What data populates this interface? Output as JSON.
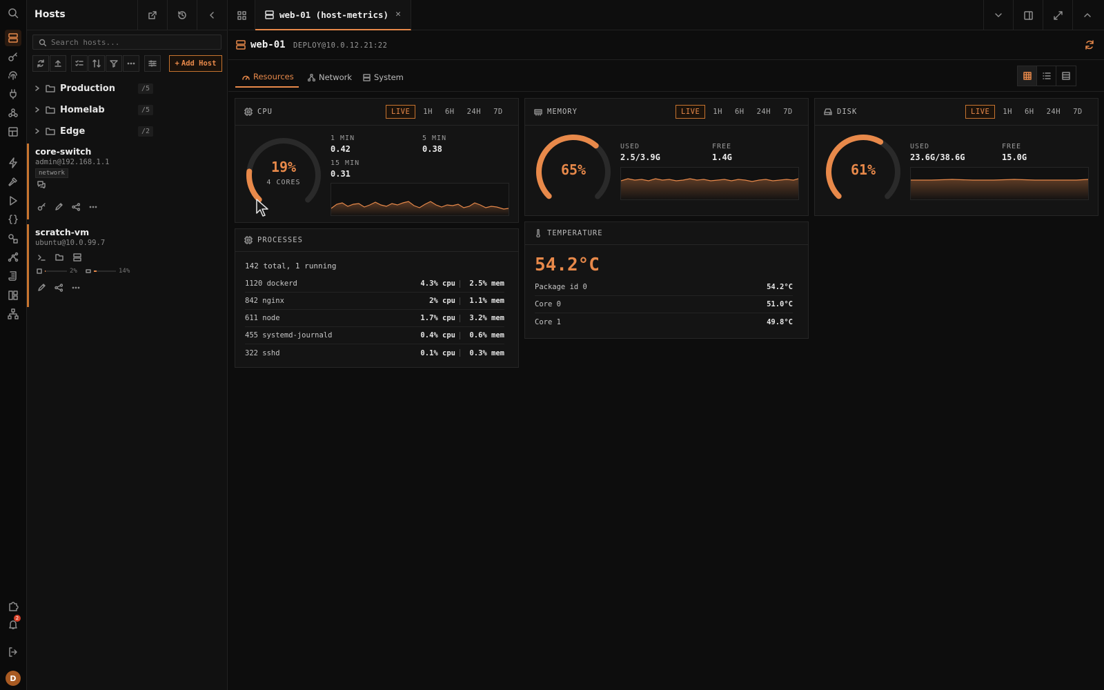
{
  "sidebar": {
    "title": "Hosts",
    "search_placeholder": "Search hosts...",
    "add_host_label": "Add Host",
    "groups": [
      {
        "name": "Production",
        "count": "/5"
      },
      {
        "name": "Homelab",
        "count": "/5"
      },
      {
        "name": "Edge",
        "count": "/2"
      }
    ],
    "hosts": [
      {
        "name": "core-switch",
        "address": "admin@192.168.1.1",
        "tag": "network"
      },
      {
        "name": "scratch-vm",
        "address": "ubuntu@10.0.99.7",
        "cpu_label": "2%",
        "cpu_fraction": 0.02,
        "mem_label": "14%",
        "mem_fraction": 0.14
      }
    ]
  },
  "rail": {
    "notification_count": "2",
    "avatar_initial": "D"
  },
  "tabs": {
    "active_label": "web-01 (host-metrics)",
    "close_glyph": "✕"
  },
  "host": {
    "name": "web-01",
    "address": "DEPLOY@10.0.12.21:22"
  },
  "subtabs": [
    "Resources",
    "Network",
    "System"
  ],
  "ranges": [
    "LIVE",
    "1H",
    "6H",
    "24H",
    "7D"
  ],
  "cpu": {
    "title": "CPU",
    "percent_label": "19%",
    "percent": 19,
    "cores_label": "4 CORES",
    "load": [
      {
        "label": "1 MIN",
        "value": "0.42"
      },
      {
        "label": "5 MIN",
        "value": "0.38"
      },
      {
        "label": "15 MIN",
        "value": "0.31"
      }
    ]
  },
  "memory": {
    "title": "MEMORY",
    "percent_label": "65%",
    "percent": 65,
    "used_label": "USED",
    "used": "2.5/3.9G",
    "free_label": "FREE",
    "free": "1.4G"
  },
  "disk": {
    "title": "DISK",
    "percent_label": "61%",
    "percent": 61,
    "used_label": "USED",
    "used": "23.6G/38.6G",
    "free_label": "FREE",
    "free": "15.0G"
  },
  "processes": {
    "title": "PROCESSES",
    "summary": "142 total, 1 running",
    "rows": [
      {
        "name": "1120 dockerd",
        "cpu": "4.3% cpu",
        "mem": "2.5% mem"
      },
      {
        "name": "842 nginx",
        "cpu": "2% cpu",
        "mem": "1.1% mem"
      },
      {
        "name": "611 node",
        "cpu": "1.7% cpu",
        "mem": "3.2% mem"
      },
      {
        "name": "455 systemd-journald",
        "cpu": "0.4% cpu",
        "mem": "0.6% mem"
      },
      {
        "name": "322 sshd",
        "cpu": "0.1% cpu",
        "mem": "0.3% mem"
      }
    ]
  },
  "temperature": {
    "title": "TEMPERATURE",
    "big": "54.2°C",
    "rows": [
      {
        "label": "Package id 0",
        "value": "54.2°C"
      },
      {
        "label": "Core 0",
        "value": "51.0°C"
      },
      {
        "label": "Core 1",
        "value": "49.8°C"
      }
    ]
  },
  "colors": {
    "accent": "#e8894a",
    "track": "#2a2a2a"
  }
}
